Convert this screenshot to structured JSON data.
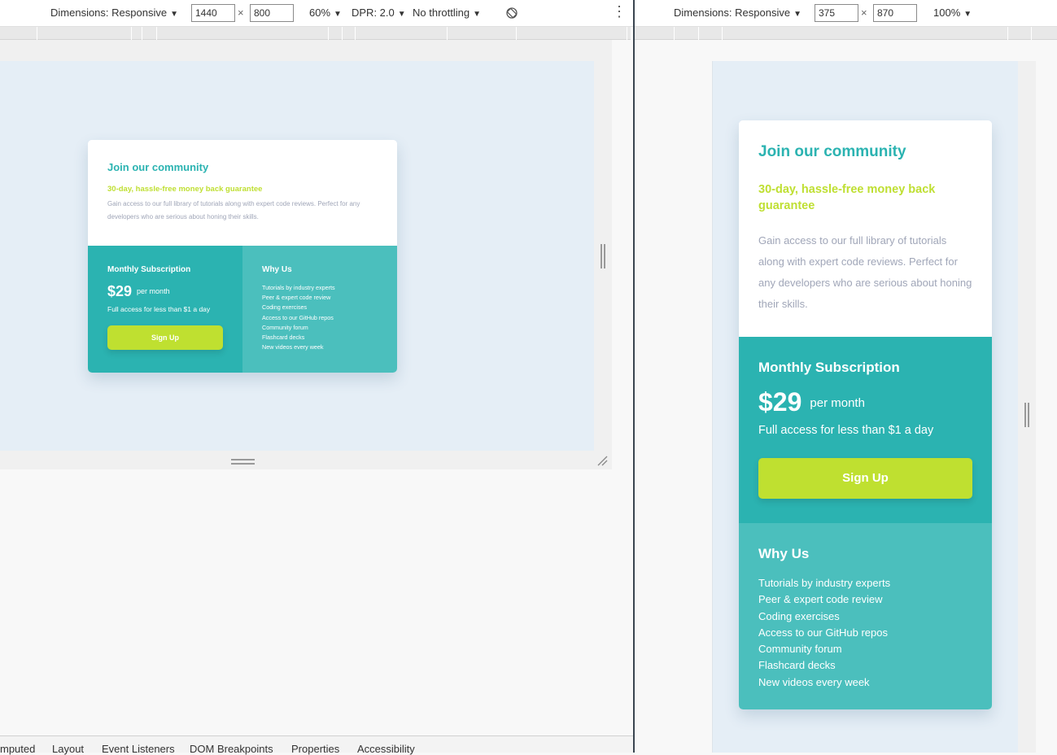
{
  "left_toolbar": {
    "dimensions_label": "Dimensions: Responsive",
    "width": "1440",
    "height": "800",
    "times": "×",
    "zoom": "60%",
    "dpr": "DPR: 2.0",
    "throttling": "No throttling",
    "caret": "▼",
    "more_icon": "⋮"
  },
  "right_toolbar": {
    "dimensions_label": "Dimensions: Responsive",
    "width": "375",
    "height": "870",
    "times": "×",
    "zoom": "100%",
    "caret": "▼"
  },
  "bottom_tabs": [
    "mputed",
    "Layout",
    "Event Listeners",
    "DOM Breakpoints",
    "Properties",
    "Accessibility"
  ],
  "card": {
    "title": "Join our community",
    "subtitle": "30-day, hassle-free money back guarantee",
    "description": "Gain access to our full library of tutorials along with expert code reviews. Perfect for any developers who are serious about honing their skills.",
    "subscription_heading": "Monthly Subscription",
    "price": "$29",
    "price_period": "per month",
    "access_text": "Full access for less than $1 a day",
    "cta_label": "Sign Up",
    "why_heading": "Why Us",
    "why_items": [
      "Tutorials by industry experts",
      "Peer & expert code review",
      "Coding exercises",
      "Access to our GitHub repos",
      "Community forum",
      "Flashcard decks",
      "New videos every week"
    ]
  },
  "colors": {
    "accent_cyan": "#2bb3b1",
    "accent_cyan_light": "#4bbfbd",
    "accent_lime": "#bfe030",
    "text_gray": "#a0a6b8",
    "page_bg": "#e5eef6"
  }
}
